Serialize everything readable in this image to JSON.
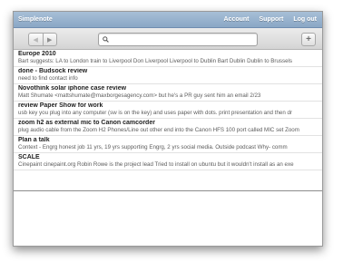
{
  "app": {
    "title": "Simplenote"
  },
  "nav": {
    "links": [
      "Account",
      "Support",
      "Log out"
    ]
  },
  "toolbar": {
    "back_glyph": "◀",
    "forward_glyph": "▶",
    "add_glyph": "+",
    "search_placeholder": "",
    "search_value": ""
  },
  "notes": [
    {
      "title": "Europe 2010",
      "snippet": "Bart suggests: LA to London train to Liverpool Don Liverpool Liverpool to Dublin Bart Dublin Dublin to Brussels"
    },
    {
      "title": "done - Budsock review",
      "snippet": "need to find contact info"
    },
    {
      "title": "Novothink solar iphone case review",
      "snippet": "Matt Shumate <mattshumate@maxborgesagency.com> but he's a PR guy sent him an email 2/23"
    },
    {
      "title": "review Paper Show for work",
      "snippet": "usb key you plug into any computer (sw is on the key) and uses paper with dots. print presentation and then dr"
    },
    {
      "title": "zoom h2 as external mic to Canon camcorder",
      "snippet": "plug audio cable from the Zoom H2 Phones/Line out other end into the Canon HFS 100 port called MIC set Zoom"
    },
    {
      "title": "Plan a talk",
      "snippet": "Context - Engrg honest job 11 yrs, 19 yrs supporting Engrg, 2 yrs social media. Outside podcast Why- comm"
    },
    {
      "title": "SCALE",
      "snippet": "Cinepaint cinepaint.org Robin Rowe is the project lead Tried to install on ubuntu but it wouldn't install as an exe"
    }
  ]
}
